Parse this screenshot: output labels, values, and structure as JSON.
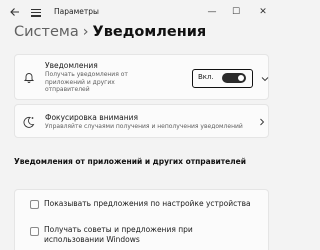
{
  "window": {
    "title": "Параметры",
    "back_icon": "arrow-left-icon",
    "menu_icon": "hamburger-icon",
    "minimize_glyph": "—",
    "maximize_glyph": "☐",
    "close_glyph": "✕"
  },
  "breadcrumb": {
    "parent": "Система",
    "separator": "›",
    "current": "Уведомления"
  },
  "notifications": {
    "title": "Уведомления",
    "description": "Получать уведомления от приложений и других отправителей",
    "toggle_label": "Вкл.",
    "toggle_on": true,
    "icon": "bell-icon"
  },
  "focus": {
    "title": "Фокусировка внимания",
    "description": "Управляйте случаями получения и неполучения уведомлений",
    "icon": "focus-moon-icon"
  },
  "section": {
    "heading": "Уведомления от приложений и других отправителей"
  },
  "options": [
    {
      "label": "Показывать предложения по настройке устройства",
      "checked": false
    },
    {
      "label": "Получать советы и предложения при использовании Windows",
      "checked": false
    }
  ]
}
